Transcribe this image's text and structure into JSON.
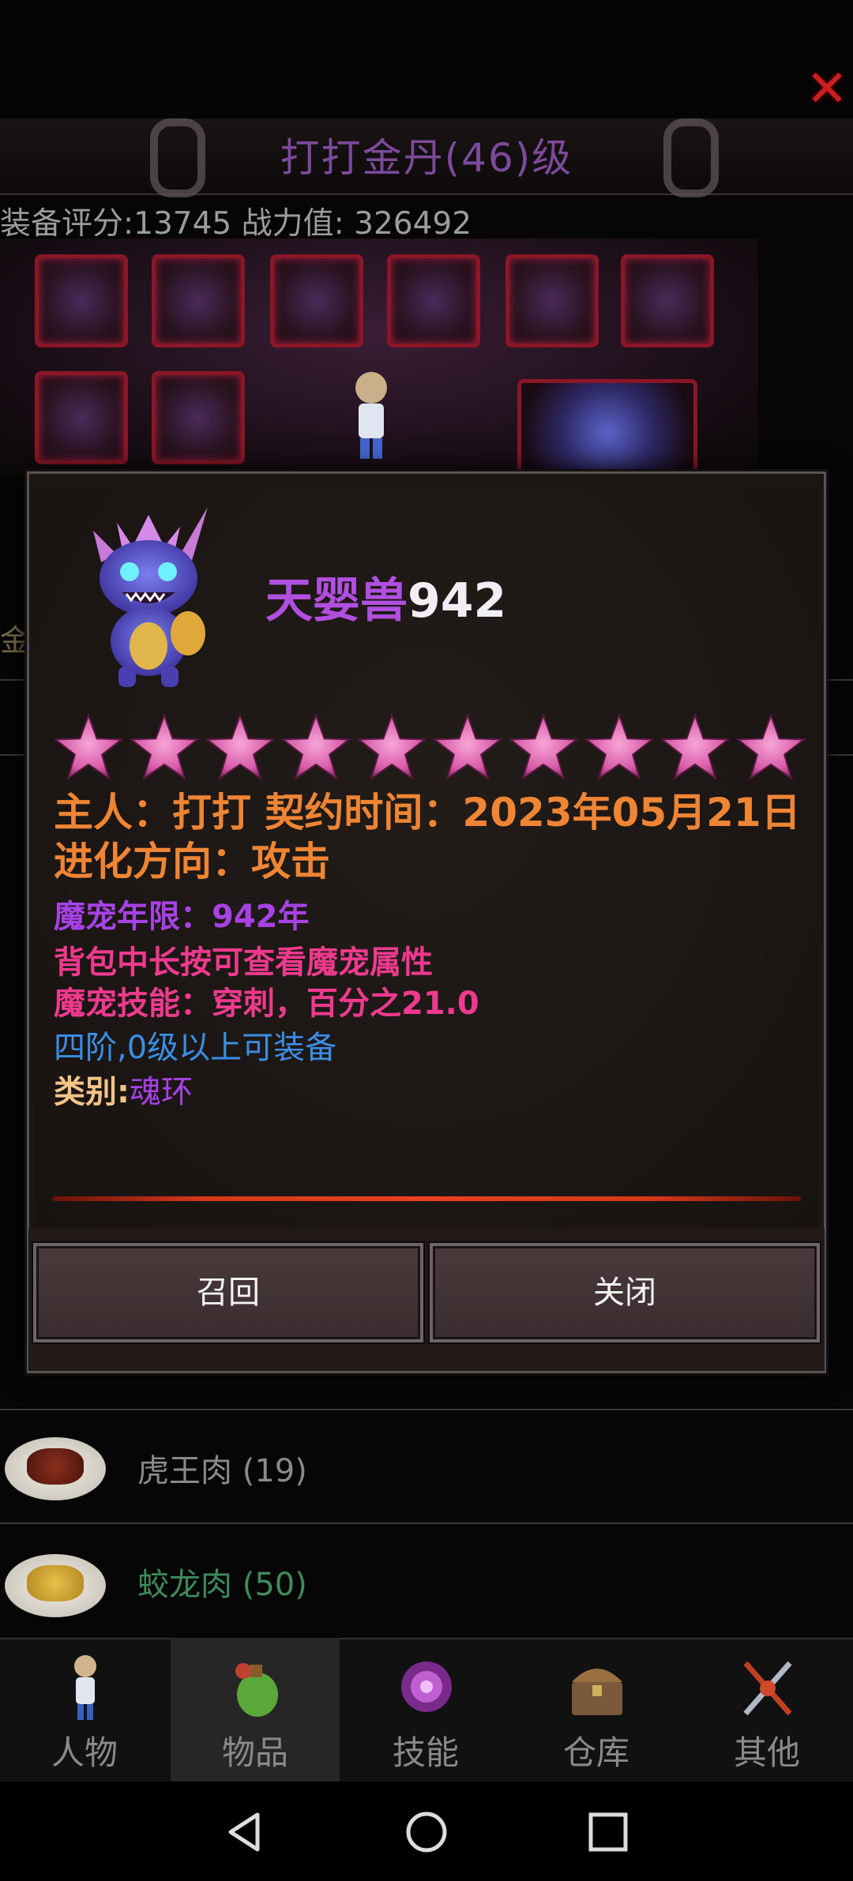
{
  "header": {
    "character_title": "打打金丹(46)级",
    "score_line": "装备评分:13745 战力值:  326492"
  },
  "pet_dialog": {
    "pet_name": "天婴兽",
    "pet_level": "942",
    "star_count": 10,
    "owner_line": "主人：打打 契约时间：2023年05月21日 进化方向：攻击",
    "age_line": "魔宠年限：942年",
    "hint_line": "背包中长按可查看魔宠属性",
    "skill_line": "魔宠技能：穿刺，百分之21.0",
    "equip_line": "四阶,0级以上可装备",
    "type_key": "类别:",
    "type_value": "魂环",
    "recall_label": "召回",
    "close_label": "关闭"
  },
  "items": [
    {
      "name": "虎王肉 (19)",
      "color": "#8a8a8a"
    },
    {
      "name": "蛟龙肉 (50)",
      "color": "#3f8a5c"
    }
  ],
  "side_fragment": "金",
  "tabs": [
    {
      "label": "人物"
    },
    {
      "label": "物品"
    },
    {
      "label": "技能"
    },
    {
      "label": "仓库"
    },
    {
      "label": "其他"
    }
  ],
  "colors": {
    "accent_purple": "#b14fe0",
    "owner_orange": "#ee8535",
    "skill_pink": "#ee3a8e",
    "equip_blue": "#3a8ee6",
    "divider_red": "#e8401f"
  }
}
